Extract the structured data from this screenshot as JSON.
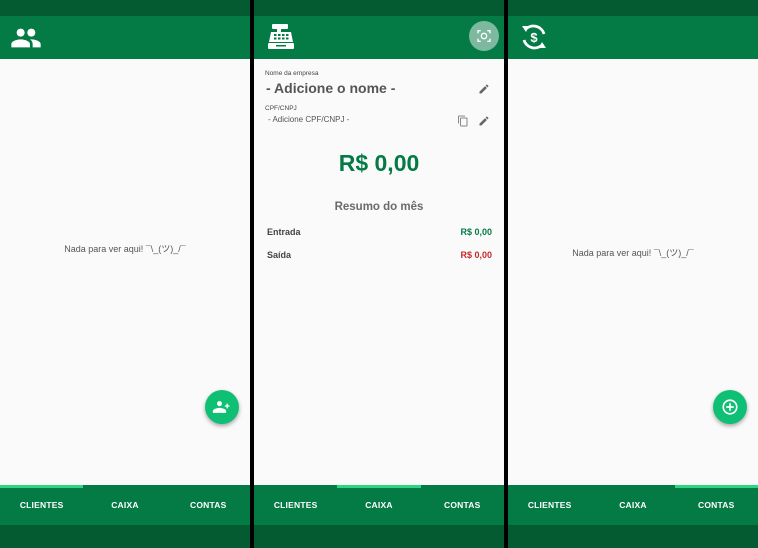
{
  "empty_message": "Nada para ver aqui! ¯\\_(ツ)_/¯",
  "tabs": [
    "CLIENTES",
    "CAIXA",
    "CONTAS"
  ],
  "caixa": {
    "company_label": "Nome da empresa",
    "company_value": "- Adicione o nome -",
    "cpf_label": "CPF/CNPJ",
    "cpf_value": "- Adicione CPF/CNPJ -",
    "balance": "R$ 0,00",
    "summary_title": "Resumo do mês",
    "entrada_label": "Entrada",
    "entrada_value": "R$ 0,00",
    "saida_label": "Saída",
    "saida_value": "R$ 0,00"
  },
  "colors": {
    "primary": "#047a45",
    "primary_dark": "#045a31",
    "accent": "#0fbf74",
    "positive": "#047a45",
    "negative": "#c62828"
  },
  "icons": {
    "clientes_header": "people-icon",
    "caixa_header": "cash-register-icon",
    "contas_header": "dollar-sync-icon",
    "add_client": "person-add-icon",
    "add_account": "plus-circle-icon",
    "scan": "scan-icon"
  }
}
